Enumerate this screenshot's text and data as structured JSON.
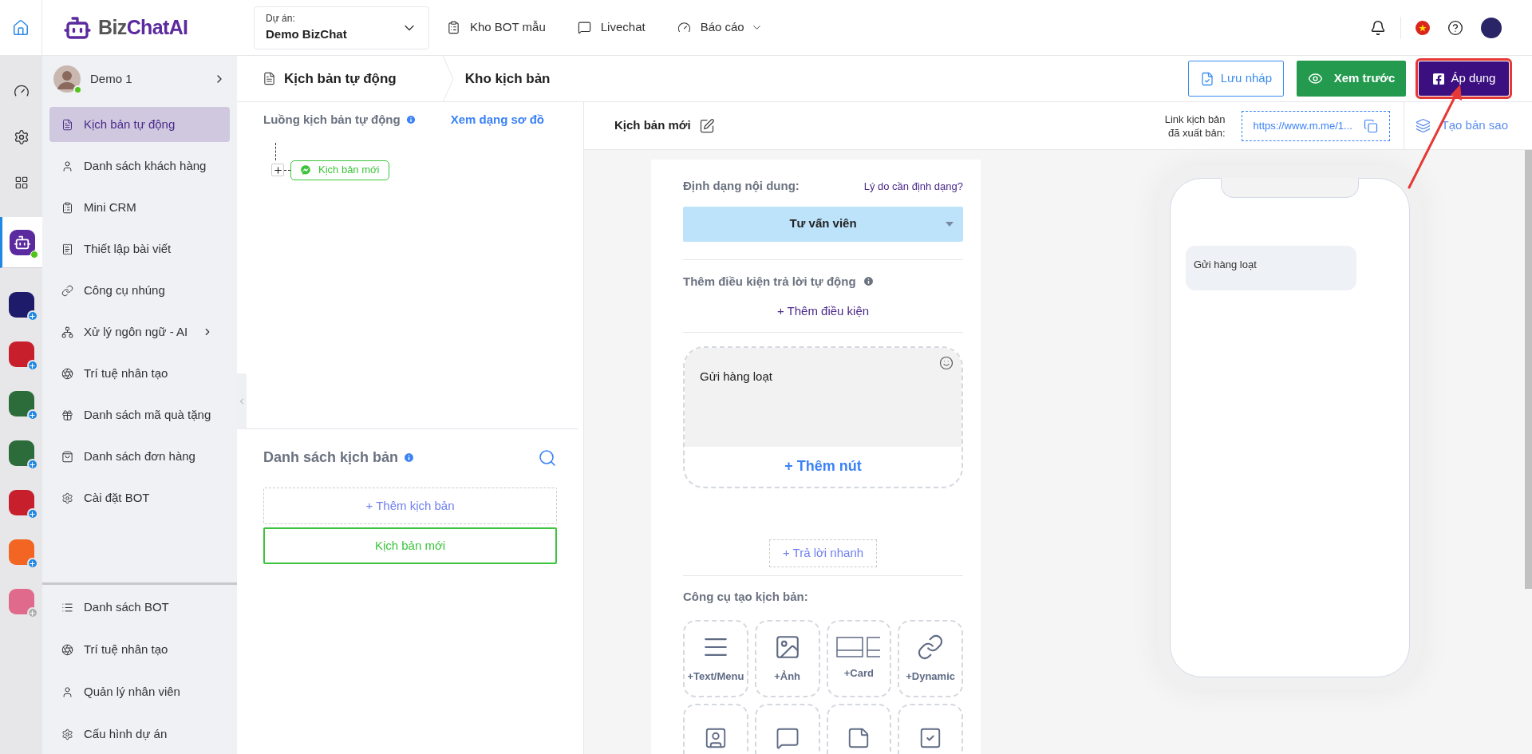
{
  "logo": {
    "part1": "Biz",
    "part2": "ChatAI"
  },
  "project": {
    "label": "Dự án:",
    "value": "Demo BizChat"
  },
  "nav": [
    {
      "label": "Kho BOT mẫu",
      "has_dropdown": false
    },
    {
      "label": "Livechat",
      "has_dropdown": false
    },
    {
      "label": "Báo cáo",
      "has_dropdown": true
    }
  ],
  "rail": {
    "apps": [
      {
        "color": "#1e1b6b",
        "enabled": true
      },
      {
        "color": "#c81f2d",
        "enabled": true
      },
      {
        "color": "#2c6b3a",
        "enabled": true
      },
      {
        "color": "#2c6b3a",
        "enabled": true
      },
      {
        "color": "#c81f2d",
        "enabled": true
      },
      {
        "color": "#f26522",
        "enabled": true
      },
      {
        "color": "#e06a8c",
        "enabled": false
      }
    ],
    "bot_selected": true
  },
  "user": {
    "name": "Demo 1",
    "online": true
  },
  "sidebar": {
    "items": [
      {
        "label": "Kịch bản tự động",
        "selected": true,
        "has_submenu": false
      },
      {
        "label": "Danh sách khách hàng",
        "selected": false,
        "has_submenu": false
      },
      {
        "label": "Mini CRM",
        "selected": false,
        "has_submenu": false
      },
      {
        "label": "Thiết lập bài viết",
        "selected": false,
        "has_submenu": false
      },
      {
        "label": "Công cụ nhúng",
        "selected": false,
        "has_submenu": false
      },
      {
        "label": "Xử lý ngôn ngữ - AI",
        "selected": false,
        "has_submenu": true
      },
      {
        "label": "Trí tuệ nhân tạo",
        "selected": false,
        "has_submenu": false
      },
      {
        "label": "Danh sách mã quà tặng",
        "selected": false,
        "has_submenu": false
      },
      {
        "label": "Danh sách đơn hàng",
        "selected": false,
        "has_submenu": false
      },
      {
        "label": "Cài đặt BOT",
        "selected": false,
        "has_submenu": false
      }
    ],
    "bottom_items": [
      {
        "label": "Danh sách BOT",
        "selected": false
      },
      {
        "label": "Trí tuệ nhân tạo",
        "selected": false
      },
      {
        "label": "Quản lý nhân viên",
        "selected": false
      },
      {
        "label": "Cấu hình dự án",
        "selected": false
      }
    ]
  },
  "breadcrumb": [
    "Kịch bản tự động",
    "Kho kịch bản"
  ],
  "actions": [
    {
      "label": "Lưu nháp",
      "kind": "draft",
      "highlighted": false
    },
    {
      "label": "Xem trước",
      "kind": "preview",
      "highlighted": false
    },
    {
      "label": "Áp dụng",
      "kind": "apply",
      "highlighted": true
    }
  ],
  "flow": {
    "title": "Luồng kịch bản tự động",
    "view_link": "Xem dạng sơ đồ",
    "nodes": [
      {
        "label": "Kịch bản mới"
      }
    ]
  },
  "scripts": {
    "title": "Danh sách kịch bản",
    "add": "+ Thêm kịch bản",
    "items": [
      {
        "label": "Kịch bản mới",
        "selected": true
      }
    ]
  },
  "editor": {
    "name": "Kịch bản mới",
    "link_label_1": "Link kịch bản",
    "link_label_2": "đã xuất bản:",
    "link": "https://www.m.me/1...",
    "copy_label": "Tạo bản sao"
  },
  "card": {
    "format_label": "Định dạng nội dung:",
    "format_help": "Lý do cần định dạng?",
    "format_value": "Tư vấn viên",
    "condition_label": "Thêm điều kiện trả lời tự động",
    "add_condition": "+ Thêm điều kiện",
    "message": "Gửi hàng loạt",
    "add_button": "+ Thêm nút",
    "quick_reply": "+ Trả lời nhanh",
    "tools_label": "Công cụ tạo kịch bản:",
    "tools": [
      {
        "label": "+Text/Menu",
        "kind": "text"
      },
      {
        "label": "+Ảnh",
        "kind": "image"
      },
      {
        "label": "+Card",
        "kind": "card"
      },
      {
        "label": "+Dynamic",
        "kind": "link"
      }
    ]
  },
  "preview": {
    "messages": [
      "Gửi hàng loạt"
    ]
  }
}
